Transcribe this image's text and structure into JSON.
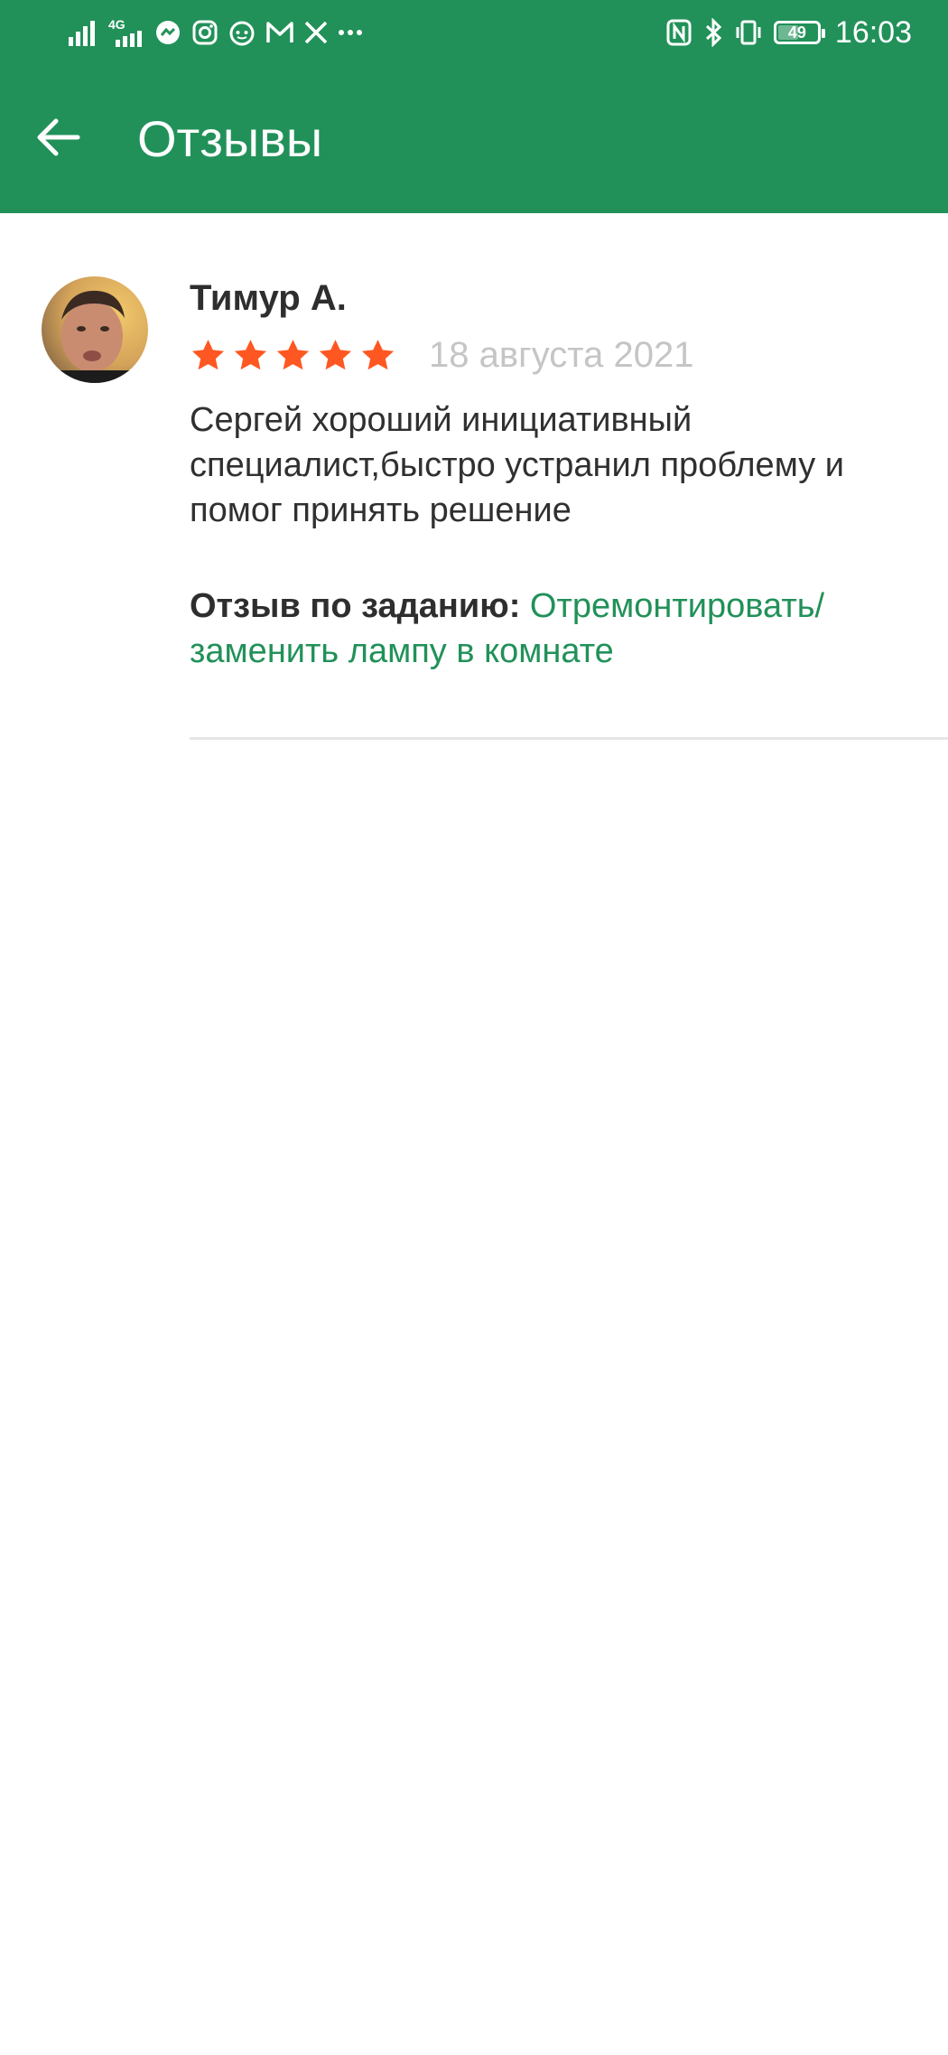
{
  "status_bar": {
    "time": "16:03",
    "battery_level": "49",
    "network_label": "4G",
    "left_icons": [
      "signal-icon",
      "signal-4g-icon",
      "messenger-icon",
      "instagram-icon",
      "reddit-icon",
      "mail-icon",
      "x-icon",
      "more-icon"
    ],
    "right_icons": [
      "nfc-icon",
      "bluetooth-icon",
      "vibrate-icon",
      "battery-icon"
    ]
  },
  "app_bar": {
    "title": "Отзывы",
    "back_icon": "arrow-left-icon"
  },
  "review": {
    "author": "Тимур А.",
    "rating": 5,
    "rating_max": 5,
    "date": "18 августа 2021",
    "text": "Сергей хороший инициативный специалист,быстро устранил проблему и помог принять решение",
    "task_label": "Отзыв по заданию:",
    "task_link": "Отремонтировать/ заменить лампу в комнате"
  },
  "colors": {
    "brand_green": "#219159",
    "star_orange": "#FF5722",
    "date_gray": "#C5C5C5"
  }
}
